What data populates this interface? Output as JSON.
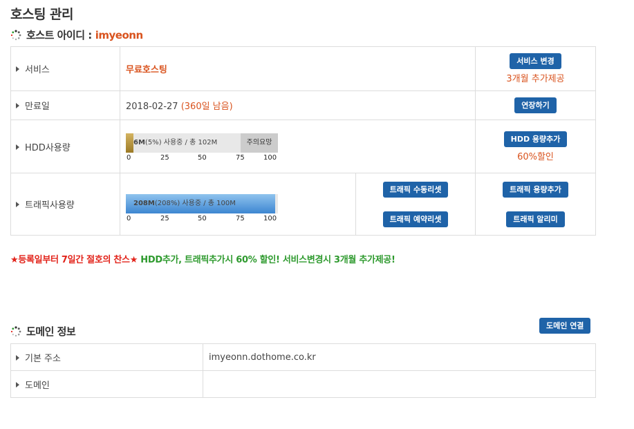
{
  "page_title": "호스팅 관리",
  "host_section": {
    "label": "호스트 아이디 :",
    "host_id": "imyeonn"
  },
  "service": {
    "label": "서비스",
    "value": "무료호스팅",
    "button": "서비스 변경",
    "promo": "3개월 추가제공"
  },
  "expiry": {
    "label": "만료일",
    "date": "2018-02-27",
    "remaining": "(360일 남음)",
    "button": "연장하기"
  },
  "hdd": {
    "label": "HDD사용량",
    "used": "6M",
    "percent_text": "(5%)",
    "detail": "사용중 / 총 102M",
    "used_fraction": 0.05,
    "warning": "주의요망",
    "ticks": [
      "0",
      "25",
      "50",
      "75",
      "100"
    ],
    "button": "HDD 용량추가",
    "promo": "60%할인"
  },
  "traffic": {
    "label": "트래픽사용량",
    "used": "208M",
    "percent_text": "(208%)",
    "detail": "사용중 / 총 100M",
    "used_fraction": 1.0,
    "ticks": [
      "0",
      "25",
      "50",
      "75",
      "100"
    ],
    "button_manual_reset": "트래픽 수동리셋",
    "button_reserve_reset": "트래픽 예약리셋",
    "button_add": "트래픽 용량추가",
    "button_alert": "트래픽 알리미"
  },
  "notice": {
    "red": "★등록일부터 7일간 절호의 찬스★",
    "green": " HDD추가, 트래픽추가시 60% 할인! 서비스변경시 3개월 추가제공!"
  },
  "domain_section": {
    "label": "도메인 정보",
    "button": "도메인 연결",
    "rows": [
      {
        "label": "기본 주소",
        "value": "imyeonn.dothome.co.kr"
      },
      {
        "label": "도메인",
        "value": ""
      }
    ]
  },
  "colors": {
    "accent": "#d9531e",
    "button": "#1f63a8",
    "notice_red": "#e2231a",
    "notice_green": "#2e9a2e"
  }
}
